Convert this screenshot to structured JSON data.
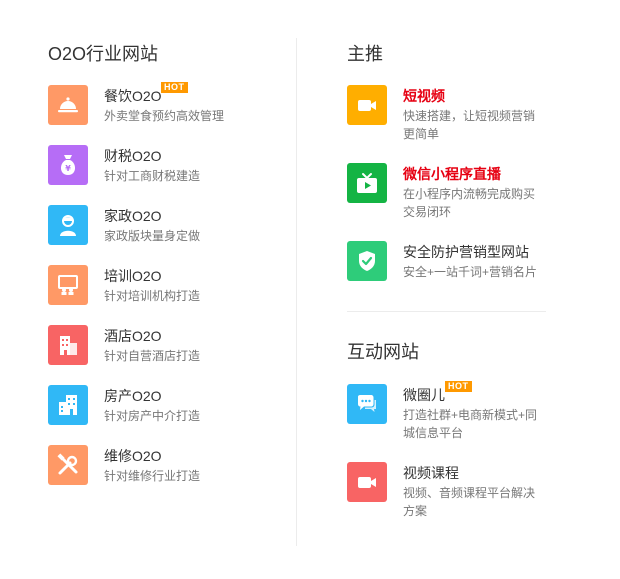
{
  "left": {
    "title": "O2O行业网站",
    "items": [
      {
        "title": "餐饮O2O",
        "desc": "外卖堂食预约高效管理",
        "icon": "cloche-icon",
        "color": "#ff9966",
        "badge": "HOT"
      },
      {
        "title": "财税O2O",
        "desc": "针对工商财税建造",
        "icon": "money-bag-icon",
        "color": "#b66df6"
      },
      {
        "title": "家政O2O",
        "desc": "家政版块量身定做",
        "icon": "housekeeper-icon",
        "color": "#30b8f6"
      },
      {
        "title": "培训O2O",
        "desc": "针对培训机构打造",
        "icon": "classroom-icon",
        "color": "#ff9966"
      },
      {
        "title": "酒店O2O",
        "desc": "针对自营酒店打造",
        "icon": "hotel-icon",
        "color": "#f86464"
      },
      {
        "title": "房产O2O",
        "desc": "针对房产中介打造",
        "icon": "building-icon",
        "color": "#30b8f6"
      },
      {
        "title": "维修O2O",
        "desc": "针对维修行业打造",
        "icon": "tools-icon",
        "color": "#ff9966"
      }
    ]
  },
  "featured": {
    "title": "主推",
    "items": [
      {
        "title": "短视频",
        "desc": "快速搭建，让短视频营销更简单",
        "icon": "video-camera-icon",
        "color": "#ffae00",
        "highlight": true
      },
      {
        "title": "微信小程序直播",
        "desc": "在小程序内流畅完成购买交易闭环",
        "icon": "tv-play-icon",
        "color": "#14b444",
        "highlight": true
      },
      {
        "title": "安全防护营销型网站",
        "desc": "安全+一站千词+营销名片",
        "icon": "shield-check-icon",
        "color": "#2ecc7a",
        "highlight": false
      }
    ]
  },
  "interactive": {
    "title": "互动网站",
    "items": [
      {
        "title": "微圈儿",
        "desc": "打造社群+电商新模式+同城信息平台",
        "icon": "chat-bubbles-icon",
        "color": "#30b8f6",
        "badge": "HOT"
      },
      {
        "title": "视频课程",
        "desc": "视频、音频课程平台解决方案",
        "icon": "video-course-icon",
        "color": "#f86464"
      }
    ]
  }
}
